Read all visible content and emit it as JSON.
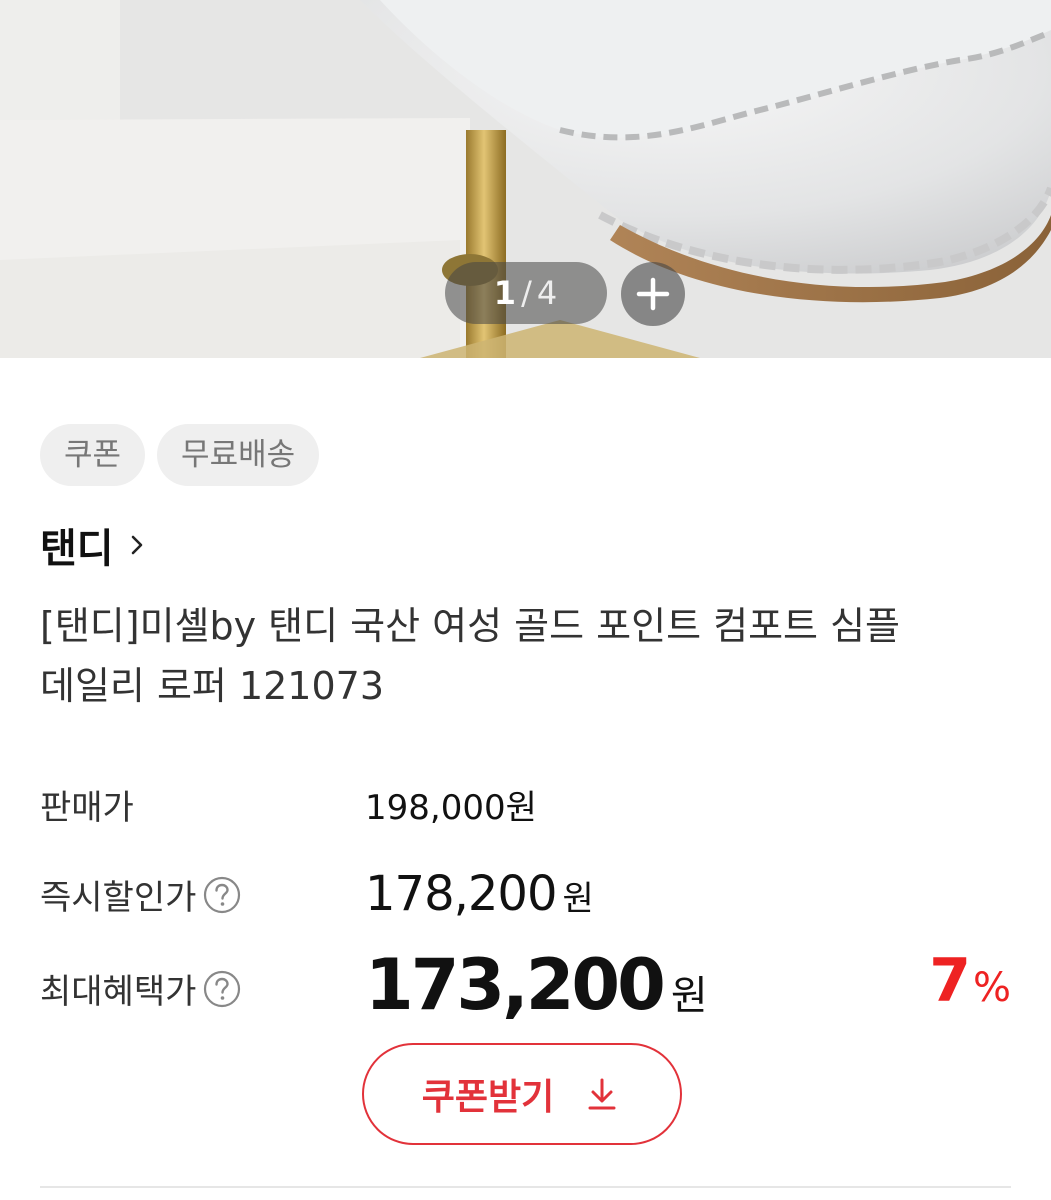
{
  "gallery": {
    "current_page": "1",
    "separator": "/",
    "total_pages": "4",
    "zoom_icon": "plus-icon"
  },
  "tags": [
    "쿠폰",
    "무료배송"
  ],
  "brand": {
    "name": "탠디",
    "chevron_icon": "chevron-right-icon"
  },
  "product": {
    "title": "[탠디]미셸by 탠디 국산 여성 골드 포인트 컴포트 심플 데일리 로퍼 121073"
  },
  "prices": {
    "sale_label": "판매가",
    "sale_value": "198,000원",
    "instant_label": "즉시할인가",
    "instant_value": "178,200",
    "instant_unit": "원",
    "max_label": "최대혜택가",
    "max_value": "173,200",
    "max_unit": "원",
    "discount_number": "7",
    "discount_unit": "%",
    "help_icon": "question-circle-icon"
  },
  "coupon": {
    "label": "쿠폰받기",
    "icon": "download-icon"
  },
  "colors": {
    "accent_red": "#e2323a",
    "discount_red": "#ee2222",
    "tag_bg": "#efefef"
  }
}
